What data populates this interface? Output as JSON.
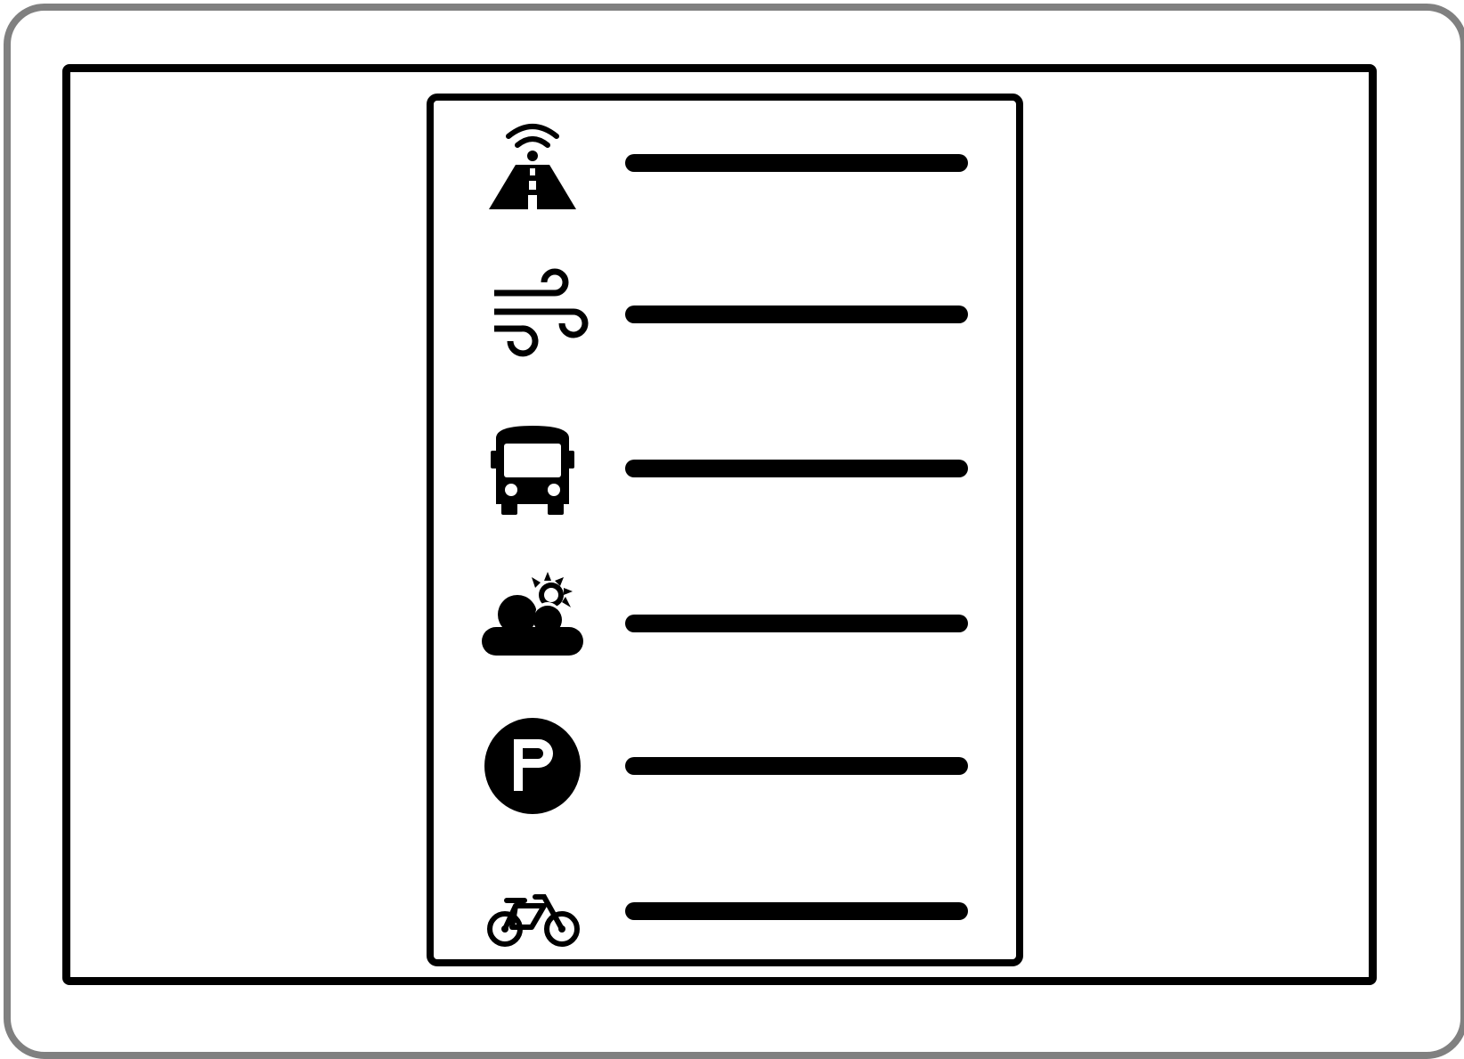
{
  "diagram": {
    "rows": [
      {
        "icon": "smart-road-icon",
        "text": ""
      },
      {
        "icon": "wind-icon",
        "text": ""
      },
      {
        "icon": "bus-icon",
        "text": ""
      },
      {
        "icon": "partly-cloudy-icon",
        "text": ""
      },
      {
        "icon": "parking-icon",
        "text": ""
      },
      {
        "icon": "bicycle-icon",
        "text": ""
      }
    ]
  },
  "colors": {
    "stroke": "#000000",
    "bezel": "#808080",
    "background": "#ffffff"
  }
}
